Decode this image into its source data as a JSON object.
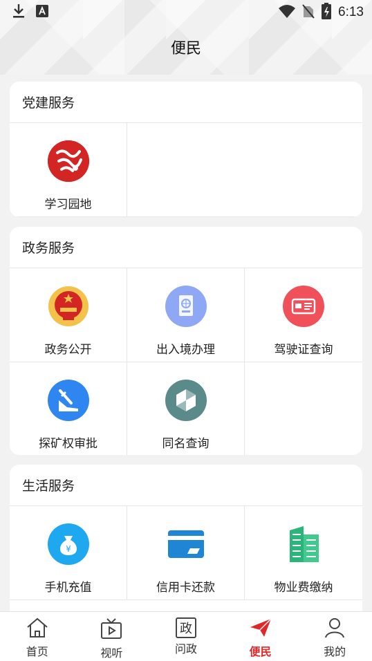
{
  "status_bar": {
    "time": "6:13"
  },
  "header": {
    "title": "便民"
  },
  "sections": {
    "party": {
      "title": "党建服务",
      "items": [
        {
          "label": "学习园地",
          "icon": "xuexi-logo-icon"
        }
      ]
    },
    "government": {
      "title": "政务服务",
      "items": [
        {
          "label": "政务公开",
          "icon": "national-emblem-icon"
        },
        {
          "label": "出入境办理",
          "icon": "passport-icon"
        },
        {
          "label": "驾驶证查询",
          "icon": "driving-license-icon"
        },
        {
          "label": "探矿权审批",
          "icon": "mining-icon"
        },
        {
          "label": "同名查询",
          "icon": "same-name-search-icon"
        }
      ]
    },
    "life": {
      "title": "生活服务",
      "items": [
        {
          "label": "手机充值",
          "icon": "money-bag-icon"
        },
        {
          "label": "信用卡还款",
          "icon": "credit-card-icon"
        },
        {
          "label": "物业费缴纳",
          "icon": "building-icon"
        }
      ]
    }
  },
  "bottom_nav": [
    {
      "label": "首页",
      "icon": "home-icon"
    },
    {
      "label": "视听",
      "icon": "tv-icon"
    },
    {
      "label": "问政",
      "icon": "zheng-icon",
      "icon_text": "政"
    },
    {
      "label": "便民",
      "icon": "paper-plane-icon",
      "active": true
    },
    {
      "label": "我的",
      "icon": "user-icon"
    }
  ],
  "colors": {
    "accent": "#e02828",
    "passport": "#8fa8f5",
    "license": "#f0505a",
    "mining": "#2f86f0",
    "same_name": "#5a8a8a",
    "money_bag": "#1ea8f0",
    "card": "#1f86d6",
    "building": "#2bb57a"
  }
}
